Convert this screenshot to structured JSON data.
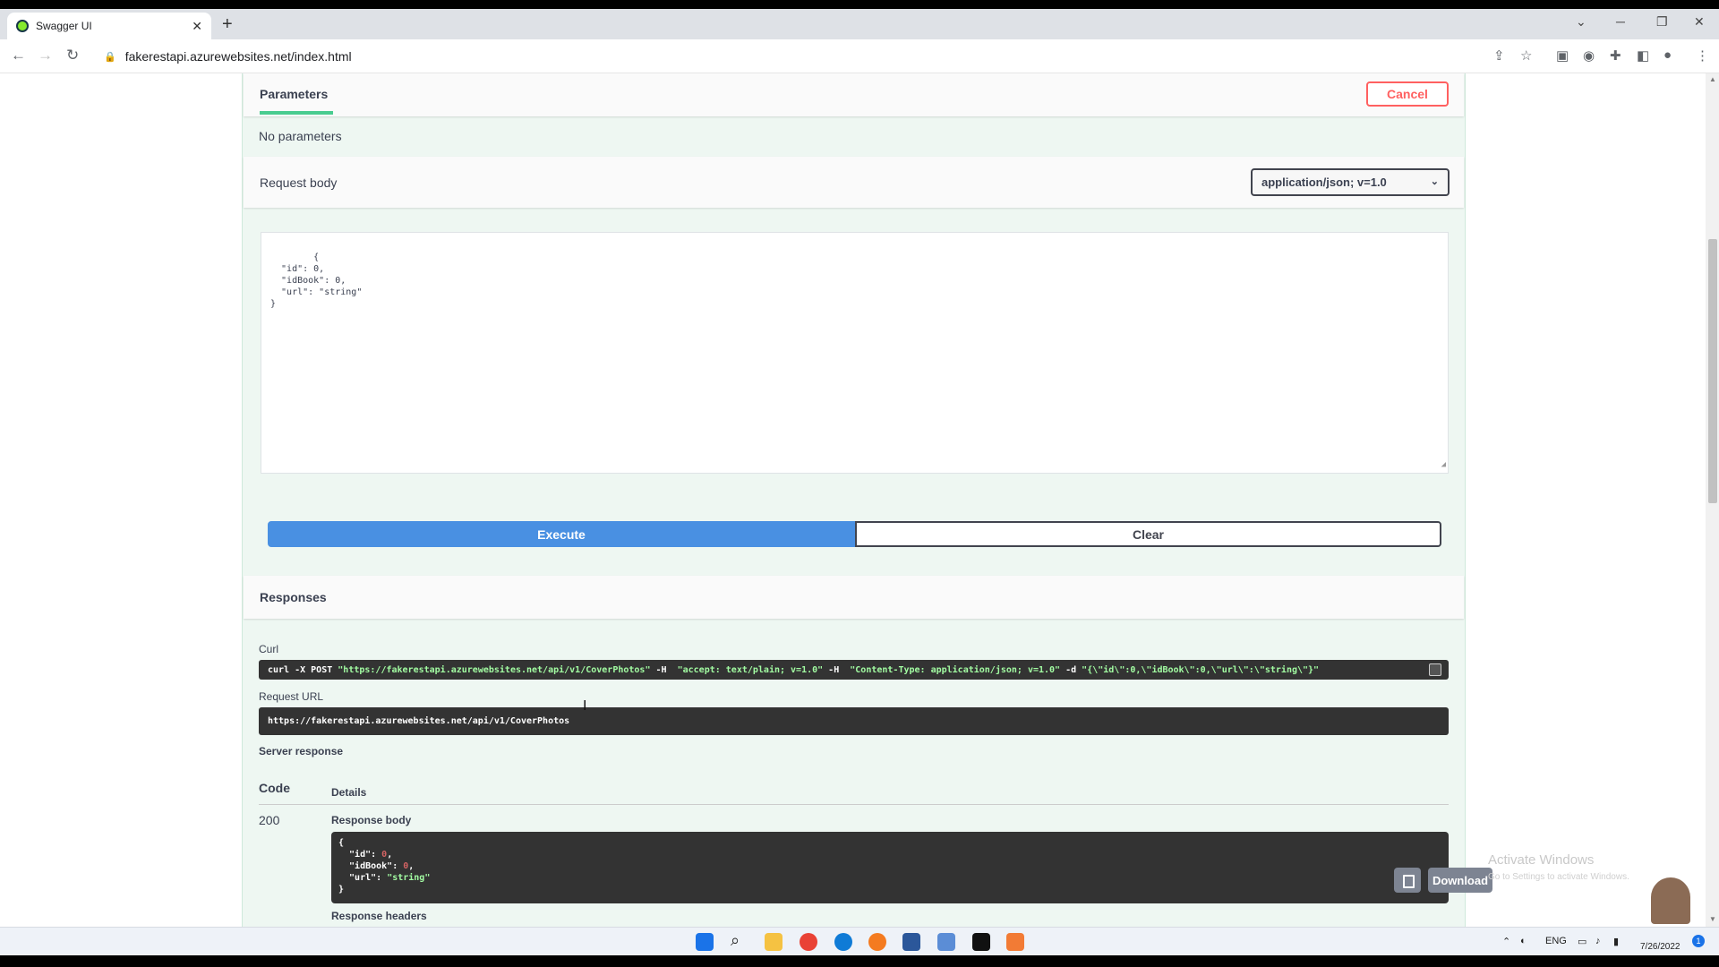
{
  "browser": {
    "tab_title": "Swagger UI",
    "tab_close": "✕",
    "new_tab": "+",
    "url": "fakerestapi.azurewebsites.net/index.html",
    "minimize": "─",
    "restore": "❐",
    "close": "✕",
    "tab_search": "⌄"
  },
  "parameters": {
    "title": "Parameters",
    "cancel_label": "Cancel",
    "no_params": "No parameters"
  },
  "request_body": {
    "label": "Request body",
    "content_type": "application/json; v=1.0",
    "json_text": "{\n  \"id\": 0,\n  \"idBook\": 0,\n  \"url\": \"string\"\n}"
  },
  "actions": {
    "execute_label": "Execute",
    "clear_label": "Clear"
  },
  "responses": {
    "title": "Responses",
    "curl_label": "Curl",
    "curl_cmd": "curl -X POST ",
    "curl_url": "\"https://fakerestapi.azurewebsites.net/api/v1/CoverPhotos\"",
    "curl_h1": " -H  ",
    "curl_accept": "\"accept: text/plain; v=1.0\"",
    "curl_h2": " -H  ",
    "curl_ctype": "\"Content-Type: application/json; v=1.0\"",
    "curl_d": " -d ",
    "curl_body": "\"{\\\"id\\\":0,\\\"idBook\\\":0,\\\"url\\\":\\\"string\\\"}\"",
    "request_url_label": "Request URL",
    "request_url": "https://fakerestapi.azurewebsites.net/api/v1/CoverPhotos",
    "server_response_label": "Server response",
    "code_header": "Code",
    "details_header": "Details",
    "code": "200",
    "response_body_label": "Response body",
    "download_label": "Download",
    "response_headers_label": "Response headers"
  },
  "watermark": {
    "title": "Activate Windows",
    "subtitle": "Go to Settings to activate Windows."
  },
  "taskbar": {
    "lang": "ENG",
    "date": "7/26/2022",
    "notif_count": "1"
  },
  "colors": {
    "post_green": "#49cc90",
    "execute_blue": "#4990e2",
    "cancel_red": "#ff6060"
  }
}
